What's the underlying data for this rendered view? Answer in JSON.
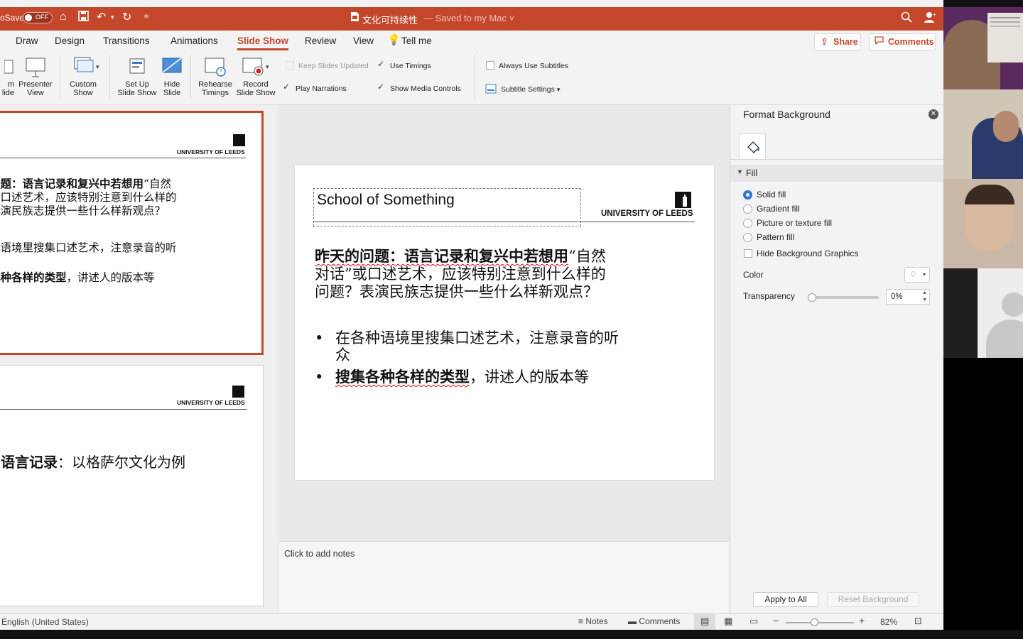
{
  "titlebar": {
    "autosave_label": "oSave",
    "autosave_state": "OFF",
    "doc_title": "文化可持续性",
    "saved_status": "— Saved to my Mac ˅"
  },
  "tabs": [
    "Draw",
    "Design",
    "Transitions",
    "Animations",
    "Slide Show",
    "Review",
    "View",
    "Tell me"
  ],
  "active_tab": "Slide Show",
  "actions": {
    "share": "Share",
    "comments": "Comments"
  },
  "ribbon": {
    "from_slide": "m\nlide",
    "presenter_view": "Presenter\nView",
    "custom_show": "Custom\nShow",
    "set_up": "Set Up\nSlide Show",
    "hide_slide": "Hide\nSlide",
    "rehearse": "Rehearse\nTimings",
    "record": "Record\nSlide Show",
    "keep_updated": "Keep Slides Updated",
    "use_timings": "Use Timings",
    "play_narrations": "Play Narrations",
    "show_media_controls": "Show Media Controls",
    "always_subtitles": "Always Use Subtitles",
    "subtitle_settings": "Subtitle Settings"
  },
  "thumbs": [
    {
      "logo_text": "UNIVERSITY OF LEEDS",
      "line1a": "问题：",
      "line1b": "语言记录和复兴中若想用",
      "line1c": "“自然",
      "line2": "或口述艺术，应该特别注意到什么样的",
      "line3": "表演民族志提供一些什么样新观点？",
      "line4": "种语境里搜集口述艺术，注意录音的听",
      "line5a": "各种各样的类型",
      "line5b": "，讲述人的版本等"
    },
    {
      "logo_text": "UNIVERSITY OF LEEDS",
      "line1a": "与语言记录",
      "line1b": "：以格萨尔文化为例"
    }
  ],
  "slide": {
    "title": "School of Something",
    "logo_text": "UNIVERSITY OF LEEDS",
    "q_bold1": "昨天的问题：",
    "q_bold2": "语言记录和复兴中若想用",
    "q_rest1": "“自然",
    "q_line2": "对话”或口述艺术，应该特别注意到什么样的",
    "q_line3": "问题？表演民族志提供一些什么样新观点？",
    "bullet1_line1": "在各种语境里搜集口述艺术，注意录音的听",
    "bullet1_line2": "众",
    "bullet2_bold": "搜集各种各样的类型",
    "bullet2_rest": "，讲述人的版本等"
  },
  "notes_placeholder": "Click to add notes",
  "format_pane": {
    "title": "Format Background",
    "section": "Fill",
    "options": [
      "Solid fill",
      "Gradient fill",
      "Picture or texture fill",
      "Pattern fill"
    ],
    "selected": "Solid fill",
    "hide_graphics": "Hide Background Graphics",
    "color_label": "Color",
    "transparency_label": "Transparency",
    "transparency_value": "0%",
    "apply_all": "Apply to All",
    "reset": "Reset Background"
  },
  "status": {
    "language": "English (United States)",
    "notes": "Notes",
    "comments": "Comments",
    "zoom": "82%"
  },
  "colors": {
    "accent": "#c4462b",
    "selected_radio": "#2a72d9"
  }
}
